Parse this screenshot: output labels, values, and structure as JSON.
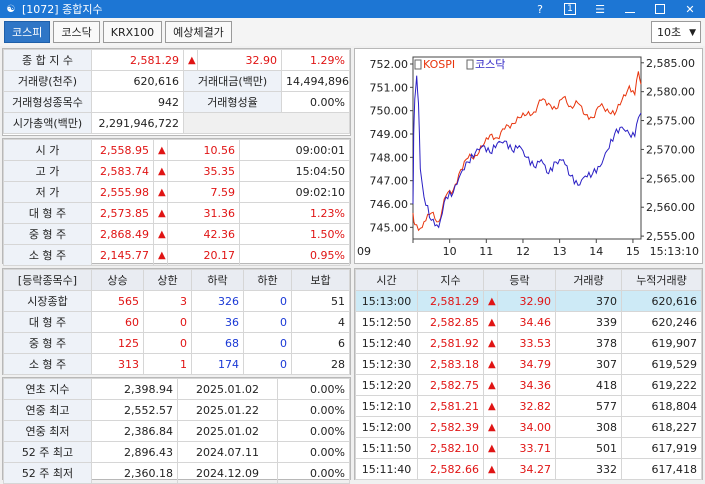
{
  "window": {
    "title": "[1072] 종합지수",
    "help_label": "?",
    "pin_label": "1"
  },
  "tabs": [
    {
      "label": "코스피",
      "active": true
    },
    {
      "label": "코스닥",
      "active": false
    },
    {
      "label": "KRX100",
      "active": false
    },
    {
      "label": "예상체결가",
      "active": false
    }
  ],
  "period": {
    "selected": "10초"
  },
  "summary": {
    "row1": {
      "label": "종 합 지 수",
      "value": "2,581.29",
      "change": "32.90",
      "rate": "1.29%"
    },
    "row2": {
      "label": "거래량(천주)",
      "value": "620,616",
      "label2": "거래대금(백만)",
      "value2": "14,494,896"
    },
    "row3": {
      "label": "거래형성종목수",
      "value": "942",
      "label2": "거래형성율",
      "value2": "0.00%"
    },
    "row4": {
      "label": "시가총액(백만)",
      "value": "2,291,946,722"
    }
  },
  "prices": [
    {
      "label": "시    가",
      "value": "2,558.95",
      "change": "10.56",
      "extra": "09:00:01"
    },
    {
      "label": "고    가",
      "value": "2,583.74",
      "change": "35.35",
      "extra": "15:04:50"
    },
    {
      "label": "저    가",
      "value": "2,555.98",
      "change": "7.59",
      "extra": "09:02:10"
    },
    {
      "label": "대 형 주",
      "value": "2,573.85",
      "change": "31.36",
      "extra": "1.23%"
    },
    {
      "label": "중 형 주",
      "value": "2,868.49",
      "change": "42.36",
      "extra": "1.50%"
    },
    {
      "label": "소 형 주",
      "value": "2,145.77",
      "change": "20.17",
      "extra": "0.95%"
    }
  ],
  "breadth": {
    "headers": [
      "[등락종목수]",
      "상승",
      "상한",
      "하락",
      "하한",
      "보합"
    ],
    "rows": [
      {
        "label": "시장종합",
        "up": "565",
        "upper": "3",
        "down": "326",
        "lower": "0",
        "flat": "51"
      },
      {
        "label": "대 형 주",
        "up": "60",
        "upper": "0",
        "down": "36",
        "lower": "0",
        "flat": "4"
      },
      {
        "label": "중 형 주",
        "up": "125",
        "upper": "0",
        "down": "68",
        "lower": "0",
        "flat": "6"
      },
      {
        "label": "소 형 주",
        "up": "313",
        "upper": "1",
        "down": "174",
        "lower": "0",
        "flat": "28"
      }
    ]
  },
  "records": [
    {
      "label": "연초  지수",
      "value": "2,398.94",
      "date": "2025.01.02",
      "rate": "0.00%"
    },
    {
      "label": "연중  최고",
      "value": "2,552.57",
      "date": "2025.01.22",
      "rate": "0.00%"
    },
    {
      "label": "연중  최저",
      "value": "2,386.84",
      "date": "2025.01.02",
      "rate": "0.00%"
    },
    {
      "label": "52 주 최고",
      "value": "2,896.43",
      "date": "2024.07.11",
      "rate": "0.00%"
    },
    {
      "label": "52 주 최저",
      "value": "2,360.18",
      "date": "2024.12.09",
      "rate": "0.00%"
    }
  ],
  "ticks": {
    "headers": [
      "시간",
      "지수",
      "등락",
      "거래량",
      "누적거래량"
    ],
    "rows": [
      {
        "time": "15:13:00",
        "index": "2,581.29",
        "change": "32.90",
        "volume": "370",
        "cum": "620,616"
      },
      {
        "time": "15:12:50",
        "index": "2,582.85",
        "change": "34.46",
        "volume": "339",
        "cum": "620,246"
      },
      {
        "time": "15:12:40",
        "index": "2,581.92",
        "change": "33.53",
        "volume": "378",
        "cum": "619,907"
      },
      {
        "time": "15:12:30",
        "index": "2,583.18",
        "change": "34.79",
        "volume": "307",
        "cum": "619,529"
      },
      {
        "time": "15:12:20",
        "index": "2,582.75",
        "change": "34.36",
        "volume": "418",
        "cum": "619,222"
      },
      {
        "time": "15:12:10",
        "index": "2,581.21",
        "change": "32.82",
        "volume": "577",
        "cum": "618,804"
      },
      {
        "time": "15:12:00",
        "index": "2,582.39",
        "change": "34.00",
        "volume": "308",
        "cum": "618,227"
      },
      {
        "time": "15:11:50",
        "index": "2,582.10",
        "change": "33.71",
        "volume": "501",
        "cum": "617,919"
      },
      {
        "time": "15:11:40",
        "index": "2,582.66",
        "change": "34.27",
        "volume": "332",
        "cum": "617,418"
      }
    ]
  },
  "chart_data": {
    "type": "line",
    "legend": [
      {
        "name": "KOSPI",
        "color": "#e8340c"
      },
      {
        "name": "코스닥",
        "color": "#2a1fc4"
      }
    ],
    "left_axis": {
      "ticks": [
        "752.00",
        "751.00",
        "750.00",
        "749.00",
        "748.00",
        "747.00",
        "746.00",
        "745.00"
      ],
      "range": [
        744.5,
        752.3
      ]
    },
    "right_axis": {
      "ticks": [
        "2,585.00",
        "2,580.00",
        "2,575.00",
        "2,570.00",
        "2,565.00",
        "2,560.00",
        "2,555.00"
      ],
      "range": [
        2554.5,
        2586.0
      ]
    },
    "x_ticks": [
      "09",
      "10",
      "11",
      "12",
      "13",
      "14",
      "15",
      "15:13:10"
    ],
    "x_hours": [
      9,
      10,
      11,
      12,
      13,
      14,
      15
    ],
    "x_range": [
      9.0,
      15.22
    ],
    "series": [
      {
        "name": "KOSPI",
        "axis": "right",
        "x": [
          9.0,
          9.05,
          9.15,
          9.3,
          9.5,
          9.7,
          9.9,
          10.1,
          10.3,
          10.5,
          10.7,
          10.9,
          11.1,
          11.3,
          11.5,
          11.7,
          11.9,
          12.1,
          12.3,
          12.5,
          12.7,
          12.9,
          13.1,
          13.3,
          13.5,
          13.7,
          13.9,
          14.1,
          14.3,
          14.5,
          14.7,
          14.9,
          15.05,
          15.15,
          15.22
        ],
        "y": [
          2559.0,
          2557.0,
          2556.0,
          2557.5,
          2559.0,
          2557.5,
          2562.0,
          2563.0,
          2566.5,
          2568.5,
          2569.0,
          2570.5,
          2572.5,
          2572.0,
          2573.5,
          2574.5,
          2575.5,
          2576.0,
          2576.5,
          2578.5,
          2578.0,
          2577.0,
          2579.0,
          2577.5,
          2578.0,
          2576.0,
          2575.5,
          2577.5,
          2577.0,
          2576.0,
          2578.5,
          2581.0,
          2579.5,
          2583.5,
          2581.3
        ]
      },
      {
        "name": "코스닥",
        "axis": "left",
        "x": [
          9.0,
          9.02,
          9.05,
          9.1,
          9.15,
          9.2,
          9.3,
          9.5,
          9.7,
          9.9,
          10.1,
          10.3,
          10.5,
          10.7,
          10.9,
          11.1,
          11.3,
          11.5,
          11.7,
          11.9,
          12.1,
          12.3,
          12.5,
          12.7,
          12.9,
          13.1,
          13.3,
          13.5,
          13.7,
          13.9,
          14.1,
          14.3,
          14.5,
          14.7,
          14.9,
          15.05,
          15.15,
          15.22
        ],
        "y": [
          746.0,
          749.0,
          750.5,
          751.5,
          750.3,
          747.5,
          746.3,
          745.3,
          745.0,
          746.3,
          746.5,
          747.3,
          747.8,
          748.2,
          748.5,
          748.2,
          748.6,
          748.7,
          748.3,
          748.5,
          748.0,
          747.6,
          747.9,
          747.3,
          747.8,
          747.9,
          747.2,
          746.8,
          747.2,
          747.3,
          747.6,
          748.3,
          749.0,
          749.3,
          749.0,
          748.9,
          749.7,
          749.9
        ]
      }
    ]
  }
}
